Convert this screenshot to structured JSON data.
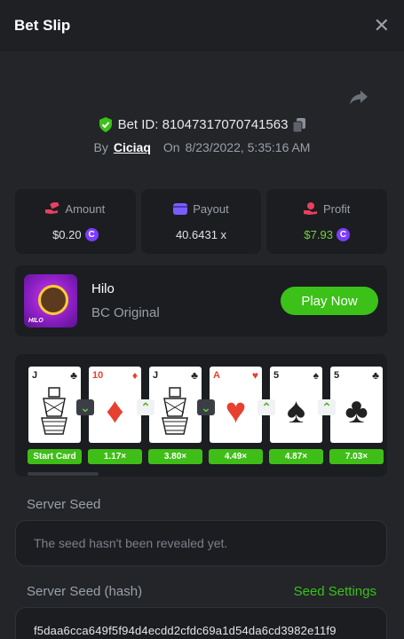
{
  "header": {
    "title": "Bet Slip",
    "close_icon": "close-icon"
  },
  "bet": {
    "id_label": "Bet ID: 81047317070741563",
    "by_label": "By",
    "user": "Ciciaq",
    "on_label": "On",
    "datetime": "8/23/2022, 5:35:16 AM"
  },
  "stats": {
    "amount": {
      "label": "Amount",
      "value": "$0.20",
      "icon": "money-hand-icon",
      "color": "#e8405f"
    },
    "payout": {
      "label": "Payout",
      "value": "40.6431 x",
      "icon": "wallet-icon",
      "color": "#7b5cff"
    },
    "profit": {
      "label": "Profit",
      "value": "$7.93",
      "icon": "profit-hand-icon",
      "color": "#e8405f"
    }
  },
  "coin_glyph": "C",
  "game": {
    "name": "Hilo",
    "subtitle": "BC Original",
    "play_label": "Play Now",
    "thumb_label": "HILO",
    "thumb_badge": "Hilo"
  },
  "cards": [
    {
      "rank": "J",
      "suit": "♣",
      "red": false,
      "court": true
    },
    {
      "rank": "10",
      "suit": "♦",
      "red": true,
      "court": false
    },
    {
      "rank": "J",
      "suit": "♣",
      "red": false,
      "court": true
    },
    {
      "rank": "A",
      "suit": "♥",
      "red": true,
      "court": false
    },
    {
      "rank": "5",
      "suit": "♠",
      "red": false,
      "court": false
    },
    {
      "rank": "5",
      "suit": "♣",
      "red": false,
      "court": false
    }
  ],
  "guesses": [
    "down",
    "up",
    "down",
    "up",
    "up"
  ],
  "multipliers": [
    "Start Card",
    "1.17×",
    "3.80×",
    "4.49×",
    "4.87×",
    "7.03×"
  ],
  "server_seed": {
    "label": "Server Seed",
    "value": "The seed hasn't been revealed yet."
  },
  "server_seed_hash": {
    "label": "Server Seed (hash)",
    "settings_label": "Seed Settings",
    "value": "f5daa6cca649f5f94d4ecdd2cfdc69a1d54da6cd3982e11f9"
  },
  "colors": {
    "accent_green": "#3bc117",
    "profit_green": "#76d13d",
    "background": "#232529",
    "panel": "#1b1d21"
  }
}
